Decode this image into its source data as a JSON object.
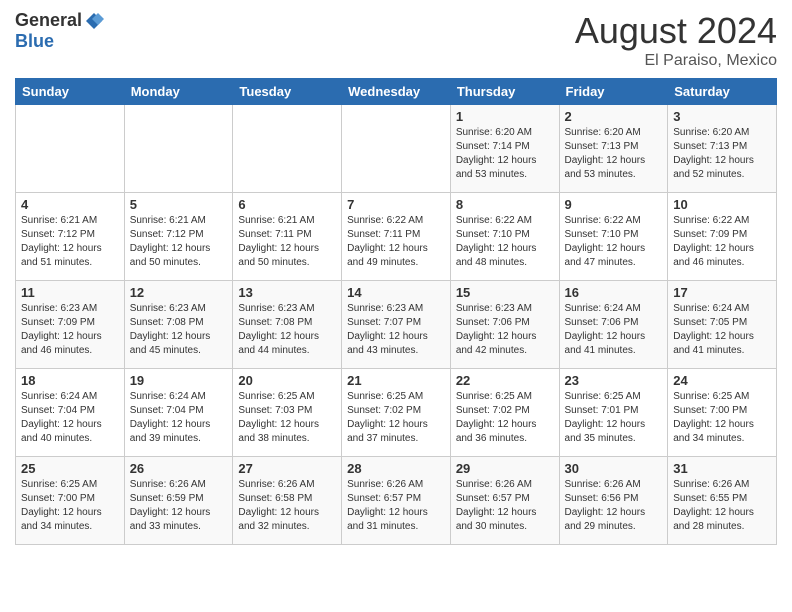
{
  "logo": {
    "general": "General",
    "blue": "Blue"
  },
  "header": {
    "title": "August 2024",
    "subtitle": "El Paraiso, Mexico"
  },
  "days_of_week": [
    "Sunday",
    "Monday",
    "Tuesday",
    "Wednesday",
    "Thursday",
    "Friday",
    "Saturday"
  ],
  "weeks": [
    [
      {
        "day": "",
        "info": ""
      },
      {
        "day": "",
        "info": ""
      },
      {
        "day": "",
        "info": ""
      },
      {
        "day": "",
        "info": ""
      },
      {
        "day": "1",
        "info": "Sunrise: 6:20 AM\nSunset: 7:14 PM\nDaylight: 12 hours\nand 53 minutes."
      },
      {
        "day": "2",
        "info": "Sunrise: 6:20 AM\nSunset: 7:13 PM\nDaylight: 12 hours\nand 53 minutes."
      },
      {
        "day": "3",
        "info": "Sunrise: 6:20 AM\nSunset: 7:13 PM\nDaylight: 12 hours\nand 52 minutes."
      }
    ],
    [
      {
        "day": "4",
        "info": "Sunrise: 6:21 AM\nSunset: 7:12 PM\nDaylight: 12 hours\nand 51 minutes."
      },
      {
        "day": "5",
        "info": "Sunrise: 6:21 AM\nSunset: 7:12 PM\nDaylight: 12 hours\nand 50 minutes."
      },
      {
        "day": "6",
        "info": "Sunrise: 6:21 AM\nSunset: 7:11 PM\nDaylight: 12 hours\nand 50 minutes."
      },
      {
        "day": "7",
        "info": "Sunrise: 6:22 AM\nSunset: 7:11 PM\nDaylight: 12 hours\nand 49 minutes."
      },
      {
        "day": "8",
        "info": "Sunrise: 6:22 AM\nSunset: 7:10 PM\nDaylight: 12 hours\nand 48 minutes."
      },
      {
        "day": "9",
        "info": "Sunrise: 6:22 AM\nSunset: 7:10 PM\nDaylight: 12 hours\nand 47 minutes."
      },
      {
        "day": "10",
        "info": "Sunrise: 6:22 AM\nSunset: 7:09 PM\nDaylight: 12 hours\nand 46 minutes."
      }
    ],
    [
      {
        "day": "11",
        "info": "Sunrise: 6:23 AM\nSunset: 7:09 PM\nDaylight: 12 hours\nand 46 minutes."
      },
      {
        "day": "12",
        "info": "Sunrise: 6:23 AM\nSunset: 7:08 PM\nDaylight: 12 hours\nand 45 minutes."
      },
      {
        "day": "13",
        "info": "Sunrise: 6:23 AM\nSunset: 7:08 PM\nDaylight: 12 hours\nand 44 minutes."
      },
      {
        "day": "14",
        "info": "Sunrise: 6:23 AM\nSunset: 7:07 PM\nDaylight: 12 hours\nand 43 minutes."
      },
      {
        "day": "15",
        "info": "Sunrise: 6:23 AM\nSunset: 7:06 PM\nDaylight: 12 hours\nand 42 minutes."
      },
      {
        "day": "16",
        "info": "Sunrise: 6:24 AM\nSunset: 7:06 PM\nDaylight: 12 hours\nand 41 minutes."
      },
      {
        "day": "17",
        "info": "Sunrise: 6:24 AM\nSunset: 7:05 PM\nDaylight: 12 hours\nand 41 minutes."
      }
    ],
    [
      {
        "day": "18",
        "info": "Sunrise: 6:24 AM\nSunset: 7:04 PM\nDaylight: 12 hours\nand 40 minutes."
      },
      {
        "day": "19",
        "info": "Sunrise: 6:24 AM\nSunset: 7:04 PM\nDaylight: 12 hours\nand 39 minutes."
      },
      {
        "day": "20",
        "info": "Sunrise: 6:25 AM\nSunset: 7:03 PM\nDaylight: 12 hours\nand 38 minutes."
      },
      {
        "day": "21",
        "info": "Sunrise: 6:25 AM\nSunset: 7:02 PM\nDaylight: 12 hours\nand 37 minutes."
      },
      {
        "day": "22",
        "info": "Sunrise: 6:25 AM\nSunset: 7:02 PM\nDaylight: 12 hours\nand 36 minutes."
      },
      {
        "day": "23",
        "info": "Sunrise: 6:25 AM\nSunset: 7:01 PM\nDaylight: 12 hours\nand 35 minutes."
      },
      {
        "day": "24",
        "info": "Sunrise: 6:25 AM\nSunset: 7:00 PM\nDaylight: 12 hours\nand 34 minutes."
      }
    ],
    [
      {
        "day": "25",
        "info": "Sunrise: 6:25 AM\nSunset: 7:00 PM\nDaylight: 12 hours\nand 34 minutes."
      },
      {
        "day": "26",
        "info": "Sunrise: 6:26 AM\nSunset: 6:59 PM\nDaylight: 12 hours\nand 33 minutes."
      },
      {
        "day": "27",
        "info": "Sunrise: 6:26 AM\nSunset: 6:58 PM\nDaylight: 12 hours\nand 32 minutes."
      },
      {
        "day": "28",
        "info": "Sunrise: 6:26 AM\nSunset: 6:57 PM\nDaylight: 12 hours\nand 31 minutes."
      },
      {
        "day": "29",
        "info": "Sunrise: 6:26 AM\nSunset: 6:57 PM\nDaylight: 12 hours\nand 30 minutes."
      },
      {
        "day": "30",
        "info": "Sunrise: 6:26 AM\nSunset: 6:56 PM\nDaylight: 12 hours\nand 29 minutes."
      },
      {
        "day": "31",
        "info": "Sunrise: 6:26 AM\nSunset: 6:55 PM\nDaylight: 12 hours\nand 28 minutes."
      }
    ]
  ]
}
